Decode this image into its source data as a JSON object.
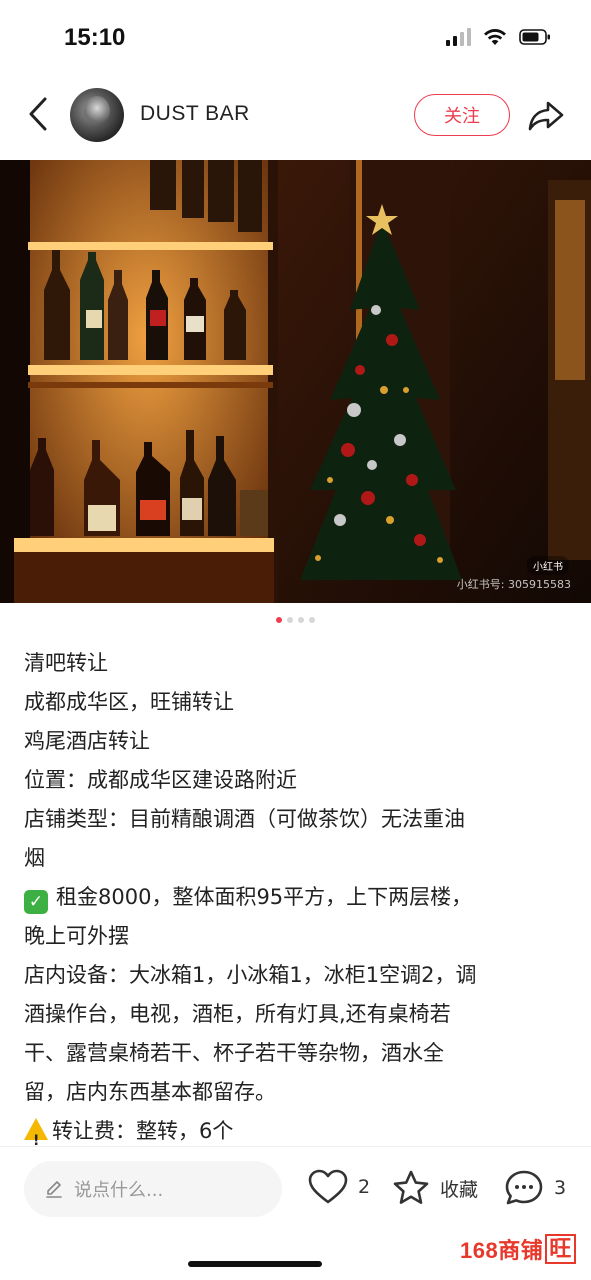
{
  "status_bar": {
    "time": "15:10"
  },
  "header": {
    "shop_name": "DUST BAR",
    "follow_label": "关注"
  },
  "photo": {
    "watermark_badge": "小红书",
    "watermark_id": "小红书号: 305915583",
    "carousel_dots": 4,
    "active_dot": 1
  },
  "post": {
    "lines": [
      "清吧转让",
      "成都成华区，旺铺转让",
      "鸡尾酒店转让",
      "位置：成都成华区建设路附近",
      "店铺类型：目前精酿调酒（可做茶饮）无法重油",
      "烟",
      "租金8000，整体面积95平方，上下两层楼，",
      "晚上可外摆",
      "店内设备：大冰箱1，小冰箱1，冰柜1空调2，调",
      "酒操作台，电视，酒柜，所有灯具,还有桌椅若",
      "干、露营桌椅若干、杯子若干等杂物，酒水全",
      "留，店内东西基本都留存。",
      "转让费：整转，6个"
    ]
  },
  "bottom_bar": {
    "comment_placeholder": "说点什么...",
    "like_count": "2",
    "collect_label": "收藏",
    "comment_count": "3",
    "brand_prefix": "168商铺",
    "brand_boxed": "旺"
  },
  "colors": {
    "accent": "#ee3d4f",
    "check_green": "#3cb043",
    "warn_yellow": "#f5b800",
    "brand_red": "#e8382b"
  }
}
